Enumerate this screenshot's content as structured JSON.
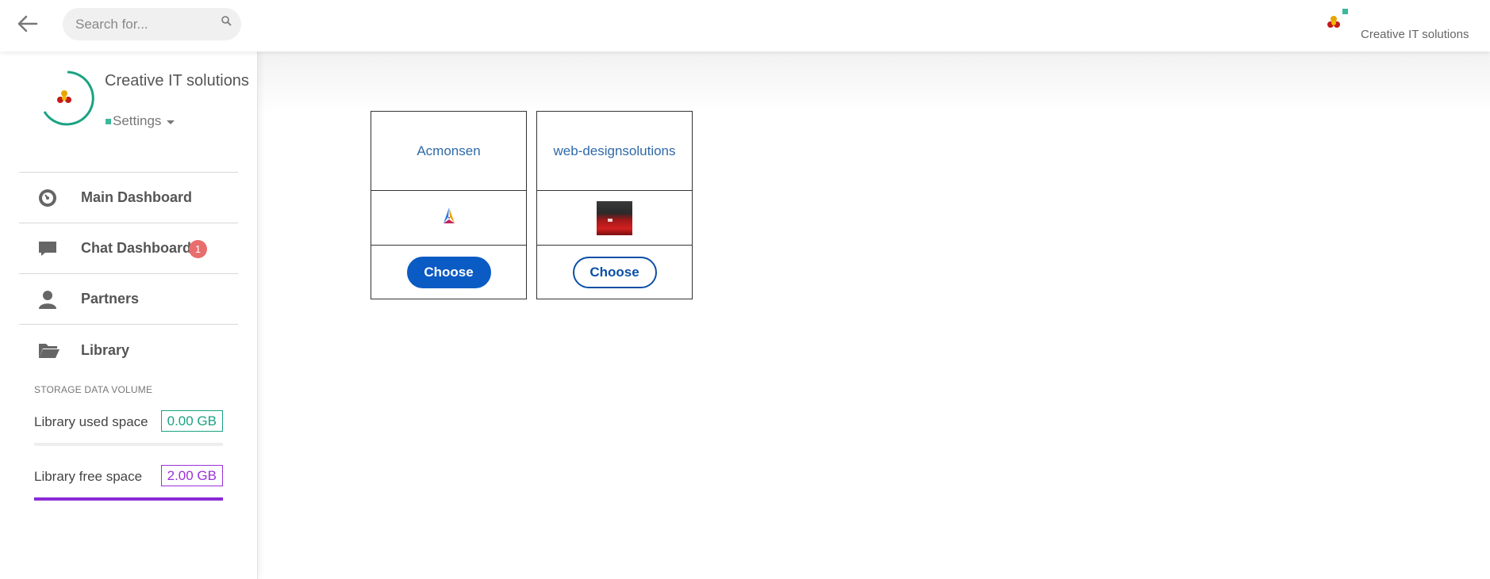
{
  "header": {
    "search_placeholder": "Search for...",
    "company_name": "Creative IT solutions"
  },
  "profile": {
    "name": "Creative IT solutions",
    "settings_label": "Settings"
  },
  "sidebar": {
    "items": [
      {
        "label": "Main Dashboard",
        "icon": "dashboard-icon"
      },
      {
        "label": "Chat Dashboard",
        "icon": "chat-icon",
        "badge": "1"
      },
      {
        "label": "Partners",
        "icon": "user-icon"
      },
      {
        "label": "Library",
        "icon": "folder-icon"
      }
    ],
    "storage": {
      "title": "STORAGE DATA VOLUME",
      "used_label": "Library used space",
      "used_value": "0.00 GB",
      "used_fraction": 0.0,
      "free_label": "Library free space",
      "free_value": "2.00 GB",
      "free_fraction": 1.0
    }
  },
  "companies": [
    {
      "name": "Acmonsen",
      "logo": "acmonsen-logo",
      "button": "Choose",
      "selected": true
    },
    {
      "name": "web-designsolutions",
      "logo": "photo-thumbnail",
      "button": "Choose",
      "selected": false
    }
  ],
  "colors": {
    "accent_green": "#1aa282",
    "accent_purple": "#9b31d8",
    "primary_blue": "#0b5bc4",
    "badge_red": "#e86d6d"
  }
}
